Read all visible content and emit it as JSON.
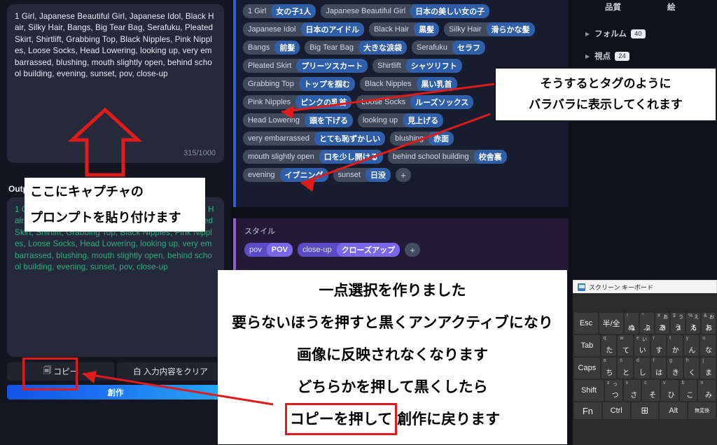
{
  "app": {
    "prompt_panel": {
      "prompt_text": "1 Girl, Japanese Beautiful Girl, Japanese Idol, Black Hair, Silky Hair, Bangs, Big Tear Bag, Serafuku, Pleated Skirt, Shirtlift, Grabbing Top, Black Nipples, Pink Nipples, Loose Socks, Head Lowering, looking up, very embarrassed, blushing, mouth slightly open, behind school building, evening, sunset, pov, close-up",
      "char_count": "315/1000"
    },
    "output_panel": {
      "label": "Output",
      "output_text": "1 Girl, Japanese Beautiful Girl, Japanese Idol, Black Hair, Silky Hair, Bangs, Big Tear Bag, Serafuku, Pleated Skirt, Shirtlift, Grabbing Top, Black Nipples, Pink Nipples, Loose Socks, Head Lowering, looking up, very embarrassed, blushing, mouth slightly open, behind school building, evening, sunset, pov, close-up"
    },
    "buttons": {
      "copy": "コピー",
      "copy_icon": "clipboard-icon",
      "clear": "入力内容をクリア",
      "clear_icon": "trash-icon",
      "create": "創作"
    },
    "tags_panel": {
      "add_label": "+",
      "chips": [
        {
          "en": "1 Girl",
          "ja": "女の子1人"
        },
        {
          "en": "Japanese Beautiful Girl",
          "ja": "日本の美しい女の子"
        },
        {
          "en": "Japanese Idol",
          "ja": "日本のアイドル"
        },
        {
          "en": "Black Hair",
          "ja": "黒髪"
        },
        {
          "en": "Silky Hair",
          "ja": "滑らかな髪"
        },
        {
          "en": "Bangs",
          "ja": "前髪"
        },
        {
          "en": "Big Tear Bag",
          "ja": "大きな涙袋"
        },
        {
          "en": "Serafuku",
          "ja": "セラフ"
        },
        {
          "en": "Pleated Skirt",
          "ja": "プリーツスカート"
        },
        {
          "en": "Shirtlift",
          "ja": "シャツリフト"
        },
        {
          "en": "Grabbing Top",
          "ja": "トップを掴む"
        },
        {
          "en": "Black Nipples",
          "ja": "黒い乳首"
        },
        {
          "en": "Pink Nipples",
          "ja": "ピンクの乳首"
        },
        {
          "en": "Loose Socks",
          "ja": "ルーズソックス"
        },
        {
          "en": "Head Lowering",
          "ja": "頭を下げる"
        },
        {
          "en": "looking up",
          "ja": "見上げる"
        },
        {
          "en": "very embarrassed",
          "ja": "とても恥ずかしい"
        },
        {
          "en": "blushing",
          "ja": "赤面"
        },
        {
          "en": "mouth slightly open",
          "ja": "口を少し開ける"
        },
        {
          "en": "behind school building",
          "ja": "校舎裏"
        },
        {
          "en": "evening",
          "ja": "イブニング"
        },
        {
          "en": "sunset",
          "ja": "日没"
        }
      ]
    },
    "style_panel": {
      "title": "スタイル",
      "add_label": "+",
      "chips": [
        {
          "en": "pov",
          "ja": "POV"
        },
        {
          "en": "close-up",
          "ja": "クローズアップ"
        }
      ]
    },
    "right_sidebar": {
      "headers": [
        "品質",
        "絵"
      ],
      "rows": [
        {
          "label": "フォルム",
          "badge": "40"
        },
        {
          "label": "視点",
          "badge": "24"
        }
      ]
    },
    "on_screen_keyboard": {
      "window_title": "スクリーン キーボード",
      "window_icon": "keyboard-window-icon",
      "rows": [
        [
          {
            "label": "Esc",
            "type": "fn"
          },
          {
            "label": "半/全",
            "type": "fn"
          },
          {
            "sup": "!",
            "sup2": "",
            "main": "1",
            "main2": "ぬ"
          },
          {
            "sup": "\"",
            "sup2": "",
            "main": "2",
            "main2": "ふ"
          },
          {
            "sup": "#",
            "sup2": "あ",
            "main": "3",
            "main2": "あ"
          },
          {
            "sup": "$",
            "sup2": "う",
            "main": "4",
            "main2": "う"
          },
          {
            "sup": "%",
            "sup2": "え",
            "main": "5",
            "main2": "え"
          },
          {
            "sup": "&",
            "sup2": "お",
            "main": "6",
            "main2": "お"
          }
        ],
        [
          {
            "label": "Tab",
            "type": "fn"
          },
          {
            "sup": "q",
            "main2": "た"
          },
          {
            "sup": "w",
            "main2": "て"
          },
          {
            "sup": "e",
            "sup2": "い",
            "main2": "い"
          },
          {
            "sup": "r",
            "main2": "す"
          },
          {
            "sup": "t",
            "main2": "か"
          },
          {
            "sup": "y",
            "main2": "ん"
          },
          {
            "sup": "u",
            "main2": "な"
          }
        ],
        [
          {
            "label": "Caps",
            "type": "fn"
          },
          {
            "sup": "a",
            "main2": "ち"
          },
          {
            "sup": "s",
            "main2": "と"
          },
          {
            "sup": "d",
            "main2": "し"
          },
          {
            "sup": "f",
            "main2": "は"
          },
          {
            "sup": "g",
            "main2": "き"
          },
          {
            "sup": "h",
            "main2": "く"
          },
          {
            "sup": "j",
            "main2": "ま"
          }
        ],
        [
          {
            "label": "Shift",
            "type": "fn"
          },
          {
            "sup": "z",
            "sup2": "っ",
            "main2": "つ"
          },
          {
            "sup": "x",
            "main2": "さ"
          },
          {
            "sup": "c",
            "main2": "そ"
          },
          {
            "sup": "v",
            "main2": "ひ"
          },
          {
            "sup": "b",
            "main2": "こ"
          },
          {
            "sup": "n",
            "main2": "み"
          }
        ],
        [
          {
            "label": "Fn",
            "type": "fn"
          },
          {
            "label": "Ctrl",
            "type": "fn"
          },
          {
            "label": "⊞",
            "type": "fn"
          },
          {
            "label": "Alt",
            "type": "fn"
          },
          {
            "label": "無変換",
            "type": "fnsm"
          }
        ]
      ]
    }
  },
  "annotations": {
    "tag_note": [
      "そうするとタグのように",
      "バラバラに表示してくれます"
    ],
    "paste_note": [
      "ここにキャプチャの",
      "プロンプトを貼り付けます"
    ],
    "main_note": [
      "一点選択を作りました",
      "要らないほうを押すと黒くアンアクティブになり",
      "画像に反映されなくなります",
      "どちらかを押して黒くしたら"
    ],
    "main_note_last_prefix": "コピーを押して",
    "main_note_last_suffix": "創作に戻ります"
  },
  "colors": {
    "accent_blue": "#2f5fd9",
    "accent_purple": "#8a5fd0",
    "chip_ja_blue": "#2f5fa8",
    "chip_ja_purple": "#7a68e8",
    "annotation_red": "#e01b1b",
    "output_green": "#2fae7e",
    "create_button": "#1b6ff0"
  }
}
